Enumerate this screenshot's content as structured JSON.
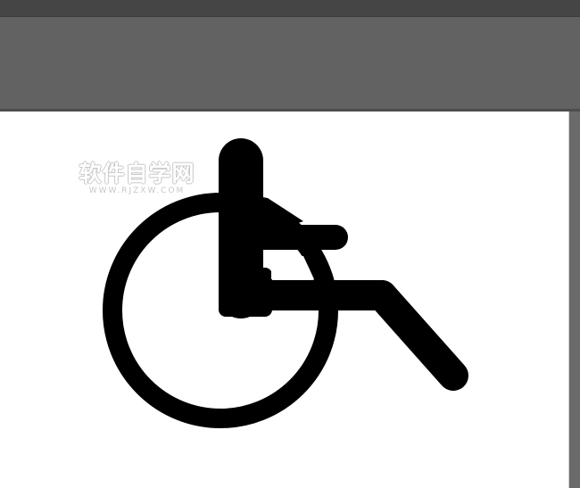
{
  "window": {
    "background_color": "#5f5f5f",
    "canvas_color": "#ffffff",
    "icon_color": "#000000"
  },
  "artwork": {
    "icon": "wheelchair-icon"
  },
  "watermark": {
    "main_text": "软件自学网",
    "sub_text": "WWW.RJZXW.COM"
  }
}
